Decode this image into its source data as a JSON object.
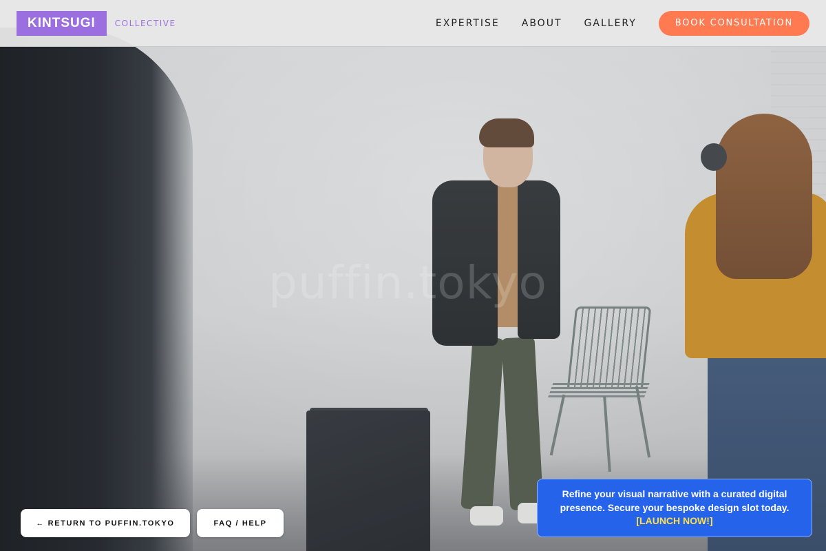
{
  "header": {
    "logo": "KINTSUGI",
    "logo_sub": "COLLECTIVE",
    "nav": [
      "EXPERTISE",
      "ABOUT",
      "GALLERY"
    ],
    "cta": "BOOK CONSULTATION"
  },
  "hero": {
    "watermark": "puffin.tokyo"
  },
  "footer_buttons": {
    "return_label": "← RETURN TO PUFFIN.TOKYO",
    "faq_label": "FAQ / HELP"
  },
  "promo": {
    "text": "Refine your visual narrative with a curated digital presence. Secure your bespoke design slot today.",
    "link": "[LAUNCH NOW!]"
  },
  "colors": {
    "brand_purple": "#9b6fe0",
    "cta_orange": "#ff7a50",
    "promo_blue": "#2563eb",
    "promo_link_yellow": "#fde047"
  }
}
